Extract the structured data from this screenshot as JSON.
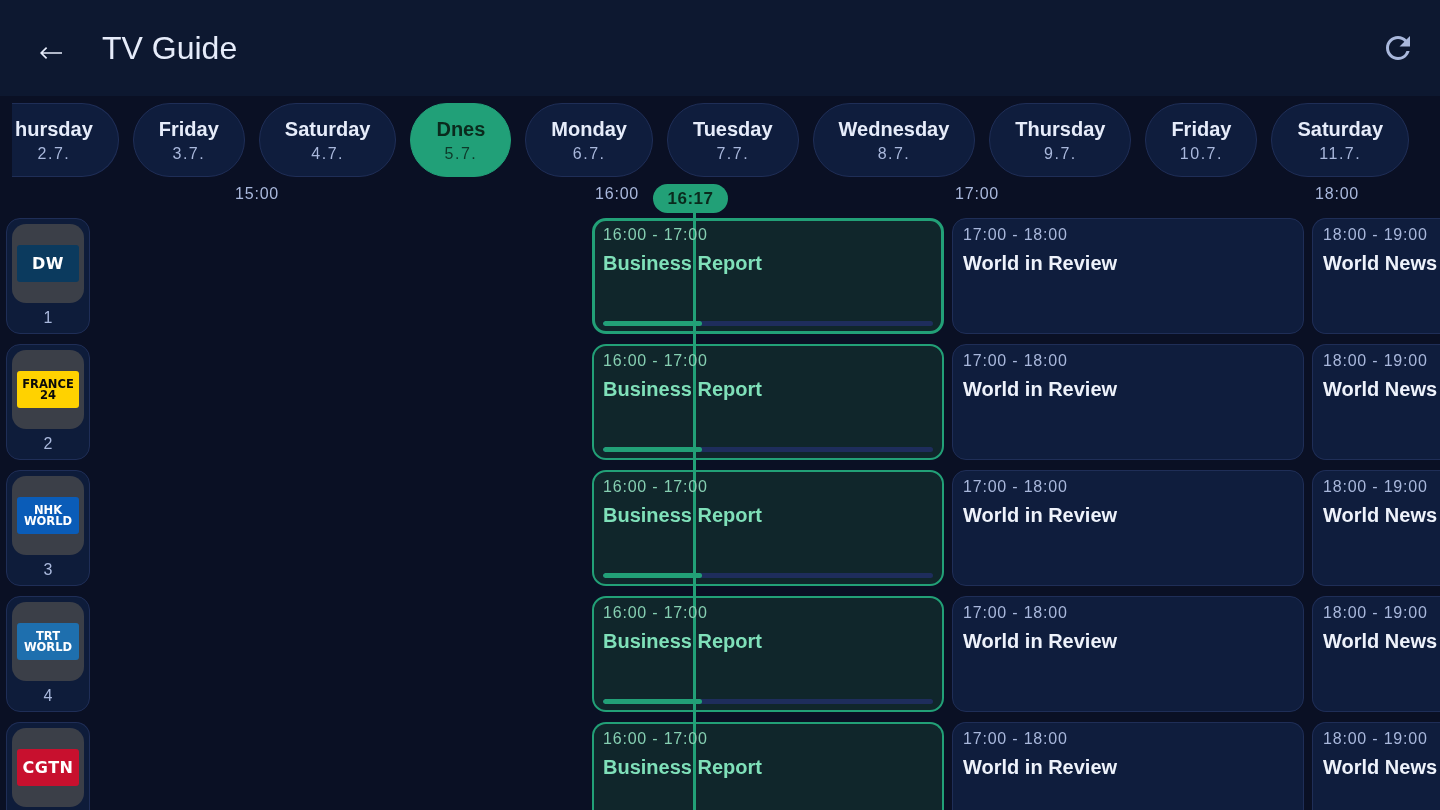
{
  "header": {
    "title": "TV Guide"
  },
  "days": [
    {
      "label": "hursday",
      "date": "2.7.",
      "selected": false,
      "clipped": true
    },
    {
      "label": "Friday",
      "date": "3.7.",
      "selected": false,
      "clipped": false
    },
    {
      "label": "Saturday",
      "date": "4.7.",
      "selected": false,
      "clipped": false
    },
    {
      "label": "Dnes",
      "date": "5.7.",
      "selected": true,
      "clipped": false
    },
    {
      "label": "Monday",
      "date": "6.7.",
      "selected": false,
      "clipped": false
    },
    {
      "label": "Tuesday",
      "date": "7.7.",
      "selected": false,
      "clipped": false
    },
    {
      "label": "Wednesday",
      "date": "8.7.",
      "selected": false,
      "clipped": false
    },
    {
      "label": "Thursday",
      "date": "9.7.",
      "selected": false,
      "clipped": false
    },
    {
      "label": "Friday",
      "date": "10.7.",
      "selected": false,
      "clipped": false
    },
    {
      "label": "Saturday",
      "date": "11.7.",
      "selected": false,
      "clipped": false
    }
  ],
  "timeline": {
    "hours": [
      "15:00",
      "16:00",
      "17:00",
      "18:00"
    ],
    "now": "16:17"
  },
  "channels": [
    {
      "number": "1",
      "logo": {
        "lines": [
          "DW"
        ],
        "color": "#0b3a5e"
      },
      "programs": [
        {
          "time": "16:00 - 17:00",
          "title": "Business Report",
          "live": true,
          "focused": true,
          "level": 0.3
        },
        {
          "time": "17:00 - 18:00",
          "title": "World in Review",
          "live": false,
          "focused": false
        },
        {
          "time": "18:00 - 19:00",
          "title": "World News",
          "live": false,
          "focused": false
        }
      ]
    },
    {
      "number": "2",
      "logo": {
        "lines": [
          "FRANCE",
          "24"
        ],
        "color": "#ffd200"
      },
      "programs": [
        {
          "time": "16:00 - 17:00",
          "title": "Business Report",
          "live": true,
          "focused": false,
          "level": 0.3
        },
        {
          "time": "17:00 - 18:00",
          "title": "World in Review",
          "live": false,
          "focused": false
        },
        {
          "time": "18:00 - 19:00",
          "title": "World News",
          "live": false,
          "focused": false
        }
      ]
    },
    {
      "number": "3",
      "logo": {
        "lines": [
          "NHK",
          "WORLD"
        ],
        "color": "#0a5cb8"
      },
      "programs": [
        {
          "time": "16:00 - 17:00",
          "title": "Business Report",
          "live": true,
          "focused": false,
          "level": 0.3
        },
        {
          "time": "17:00 - 18:00",
          "title": "World in Review",
          "live": false,
          "focused": false
        },
        {
          "time": "18:00 - 19:00",
          "title": "World News",
          "live": false,
          "focused": false
        }
      ]
    },
    {
      "number": "4",
      "logo": {
        "lines": [
          "TRT",
          "WORLD"
        ],
        "color": "#1e6fae"
      },
      "programs": [
        {
          "time": "16:00 - 17:00",
          "title": "Business Report",
          "live": true,
          "focused": false,
          "level": 0.3
        },
        {
          "time": "17:00 - 18:00",
          "title": "World in Review",
          "live": false,
          "focused": false
        },
        {
          "time": "18:00 - 19:00",
          "title": "World News",
          "live": false,
          "focused": false
        }
      ]
    },
    {
      "logo": {
        "lines": [
          "CGTN"
        ],
        "color": "#c8102e"
      },
      "programs": [
        {
          "time": "16:00 - 17:00",
          "title": "Business Report",
          "live": true,
          "focused": false
        },
        {
          "time": "17:00 - 18:00",
          "title": "World in Review",
          "live": false,
          "focused": false
        },
        {
          "time": "18:00 - 19:00",
          "title": "World News",
          "live": false,
          "focused": false
        }
      ]
    }
  ]
}
